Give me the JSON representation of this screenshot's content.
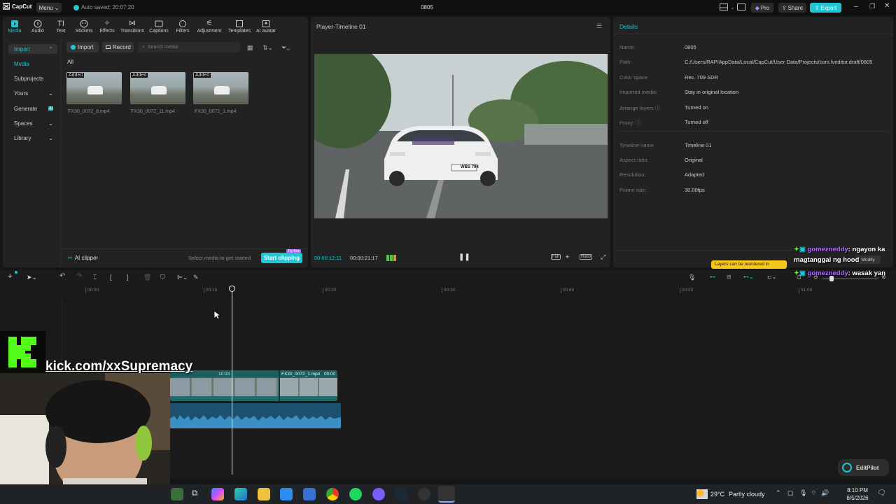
{
  "app": {
    "logo_text": "CapCut",
    "menu_label": "Menu",
    "autosave": "Auto saved: 20:07:20",
    "project_title": "0805",
    "pro_label": "Pro",
    "share_label": "Share",
    "export_label": "Export"
  },
  "toptabs": [
    "Media",
    "Audio",
    "Text",
    "Stickers",
    "Effects",
    "Transitions",
    "Captions",
    "Filters",
    "Adjustment",
    "Templates",
    "AI avatar"
  ],
  "sidebar": {
    "items": [
      "Import",
      "Media",
      "Subprojects",
      "Yours",
      "Generate",
      "Spaces",
      "Library"
    ],
    "generate_badge": "AI"
  },
  "media": {
    "import_label": "Import",
    "record_label": "Record",
    "search_placeholder": "Search media",
    "filter_all": "All",
    "items": [
      {
        "badge": "Added",
        "name": "FX30_0072_8.mp4"
      },
      {
        "badge": "Added",
        "name": "FX30_0072_11.mp4"
      },
      {
        "badge": "Added",
        "name": "FX30_0072_1.mp4"
      }
    ],
    "ai_clipper": "AI clipper",
    "select_hint": "Select media to get started",
    "start_clipping": "Start clipping",
    "try_free": "Try free"
  },
  "player": {
    "title": "Player-Timeline 01",
    "current_time": "00:00:12:11",
    "total_time": "00:00:21:17",
    "full_label": "Full",
    "ratio_label": "Ratio",
    "plate": "WBS 794"
  },
  "details": {
    "title": "Details",
    "rows": [
      {
        "k": "Name:",
        "v": "0805"
      },
      {
        "k": "Path:",
        "v": "C:/Users/RAP/AppData/Local/CapCut/User Data/Projects/com.lveditor.draft/0805"
      },
      {
        "k": "Color space",
        "v": "Rec. 709 SDR"
      },
      {
        "k": "Imported media:",
        "v": "Stay in original location"
      },
      {
        "k": "Arrange layers ⓘ",
        "v": "Turned on"
      },
      {
        "k": "Proxy: ⓘ",
        "v": "Turned off"
      },
      {
        "k": "Timeline name",
        "v": "Timeline 01"
      },
      {
        "k": "Aspect ratio:",
        "v": "Original"
      },
      {
        "k": "Resolution:",
        "v": "Adapted"
      },
      {
        "k": "Frame rate:",
        "v": "30.00fps"
      }
    ],
    "modify_label": "Modify",
    "layers_tip": "Layers can be reordered in"
  },
  "timeline": {
    "ticks": [
      "00:00",
      "00:10",
      "00:20",
      "00:30",
      "00:40",
      "00:50",
      "01:00"
    ],
    "clip_label_1": "10:03",
    "clip_label_2": "FX30_0072_1.mp4",
    "clip_label_2_dur": "00:00"
  },
  "stream": {
    "kick_text": "kick.com/xxSupremacy",
    "chat": [
      {
        "user": "gomezneddy",
        "msg": ": ngayon ka magtanggal ng hood"
      },
      {
        "user": "gomezneddy",
        "msg": ": wasak yan"
      }
    ]
  },
  "editpilot_label": "EditPilot",
  "taskbar": {
    "weather_temp": "29°C",
    "weather_text": "Partly cloudy",
    "time": "8:10 PM",
    "date": "8/5/2026"
  },
  "colors": {
    "accent": "#1fc7d4",
    "kick_green": "#53fc18",
    "chat_user": "#b36cff"
  }
}
